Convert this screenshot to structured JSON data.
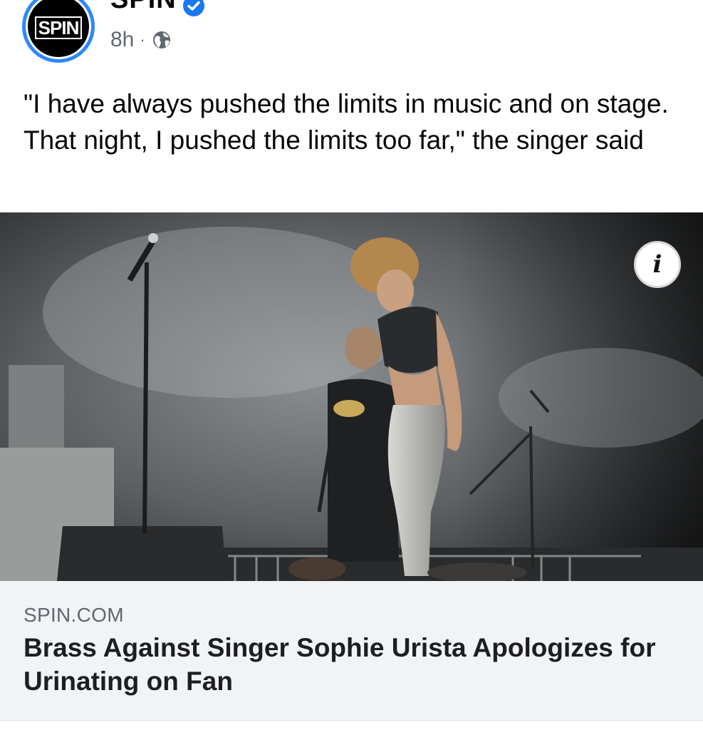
{
  "post": {
    "page_name": "SPIN",
    "avatar_text": "SPIN",
    "verified_icon": "verified-badge-icon",
    "time": "8h",
    "separator": "·",
    "audience_icon": "globe-icon",
    "text": "\"I have always pushed the limits in music and on stage. That night, I pushed the limits too far,\" the singer said"
  },
  "media": {
    "info_label": "i"
  },
  "link_preview": {
    "domain": "SPIN.COM",
    "title": "Brass Against Singer Sophie Urista Apologizes for Urinating on Fan"
  },
  "colors": {
    "verified": "#1877f2",
    "avatar_ring": "#2d88ff",
    "preview_bg": "#f2f3f5",
    "meta_text": "#606770"
  }
}
